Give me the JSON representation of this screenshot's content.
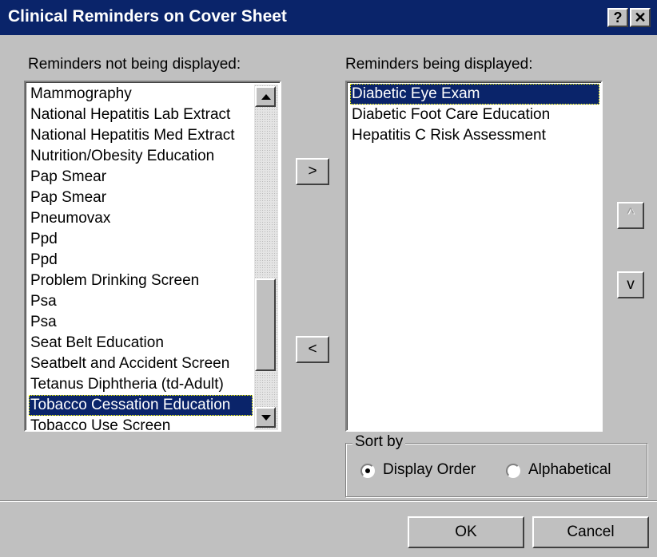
{
  "window": {
    "title": "Clinical Reminders on Cover Sheet",
    "help_label": "?",
    "close_label": "✕"
  },
  "left": {
    "label": "Reminders not being displayed:",
    "items": [
      "Mammography",
      "National Hepatitis Lab Extract",
      "National Hepatitis Med Extract",
      "Nutrition/Obesity Education",
      "Pap Smear",
      "Pap Smear",
      "Pneumovax",
      "Ppd",
      "Ppd",
      "Problem Drinking Screen",
      "Psa",
      "Psa",
      "Seat Belt Education",
      "Seatbelt and Accident Screen",
      "Tetanus Diphtheria (td-Adult)",
      "Tobacco Cessation Education",
      "Tobacco Use Screen"
    ],
    "selected_index": 15
  },
  "right": {
    "label": "Reminders being displayed:",
    "items": [
      "Diabetic Eye Exam",
      "Diabetic Foot Care Education",
      "Hepatitis C Risk Assessment"
    ],
    "selected_index": 0
  },
  "buttons": {
    "add": ">",
    "remove": "<",
    "move_up": "^",
    "move_down": "v",
    "ok": "OK",
    "cancel": "Cancel"
  },
  "sort": {
    "legend": "Sort by",
    "options": [
      "Display Order",
      "Alphabetical"
    ],
    "selected": "Display Order"
  }
}
